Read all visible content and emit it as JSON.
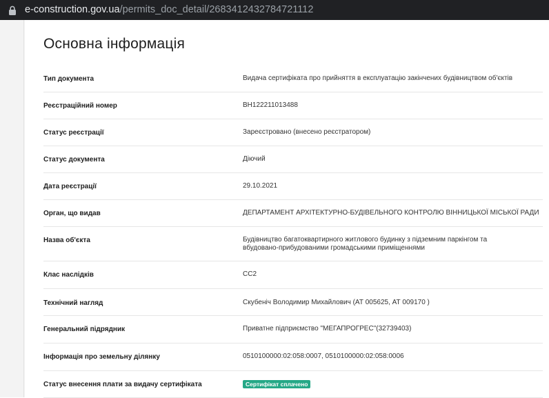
{
  "browser": {
    "url_host": "e-construction.gov.ua",
    "url_path": "/permits_doc_detail/2683412432784721112"
  },
  "page": {
    "title": "Основна інформація"
  },
  "info": {
    "rows": [
      {
        "label": "Тип документа",
        "value": "Видача сертифіката про прийняття в експлуатацію закінчених будівництвом об'єктів"
      },
      {
        "label": "Реєстраційний номер",
        "value": "ВН122211013488"
      },
      {
        "label": "Статус реєстрації",
        "value": "Зареєстровано (внесено реєстратором)"
      },
      {
        "label": "Статус документа",
        "value": "Діючий"
      },
      {
        "label": "Дата реєстрації",
        "value": "29.10.2021"
      },
      {
        "label": "Орган, що видав",
        "value": "ДЕПАРТАМЕНТ АРХІТЕКТУРНО-БУДІВЕЛЬНОГО КОНТРОЛЮ ВІННИЦЬКОЇ МІСЬКОЇ РАДИ"
      },
      {
        "label": "Назва об'єкта",
        "value": "Будівництво багатоквартирного житлового будинку з підземним паркінгом та вбудовано-прибудованими громадськими приміщеннями"
      },
      {
        "label": "Клас наслідків",
        "value": "СС2"
      },
      {
        "label": "Технічний нагляд",
        "value": "Скубеніч Володимир Михайлович (АТ 005625, АТ 009170 )"
      },
      {
        "label": "Генеральний підрядник",
        "value": "Приватне підприємство \"МЕГАПРОГРЕС\"(32739403)"
      },
      {
        "label": "Інформація про земельну ділянку",
        "value": "0510100000:02:058:0007, 0510100000:02:058:0006"
      },
      {
        "label": "Статус внесення плати за видачу сертифіката",
        "value": "Сертифікат сплачено"
      }
    ]
  },
  "colors": {
    "badge_paid": "#26a887",
    "addressbar_bg": "#202124"
  }
}
